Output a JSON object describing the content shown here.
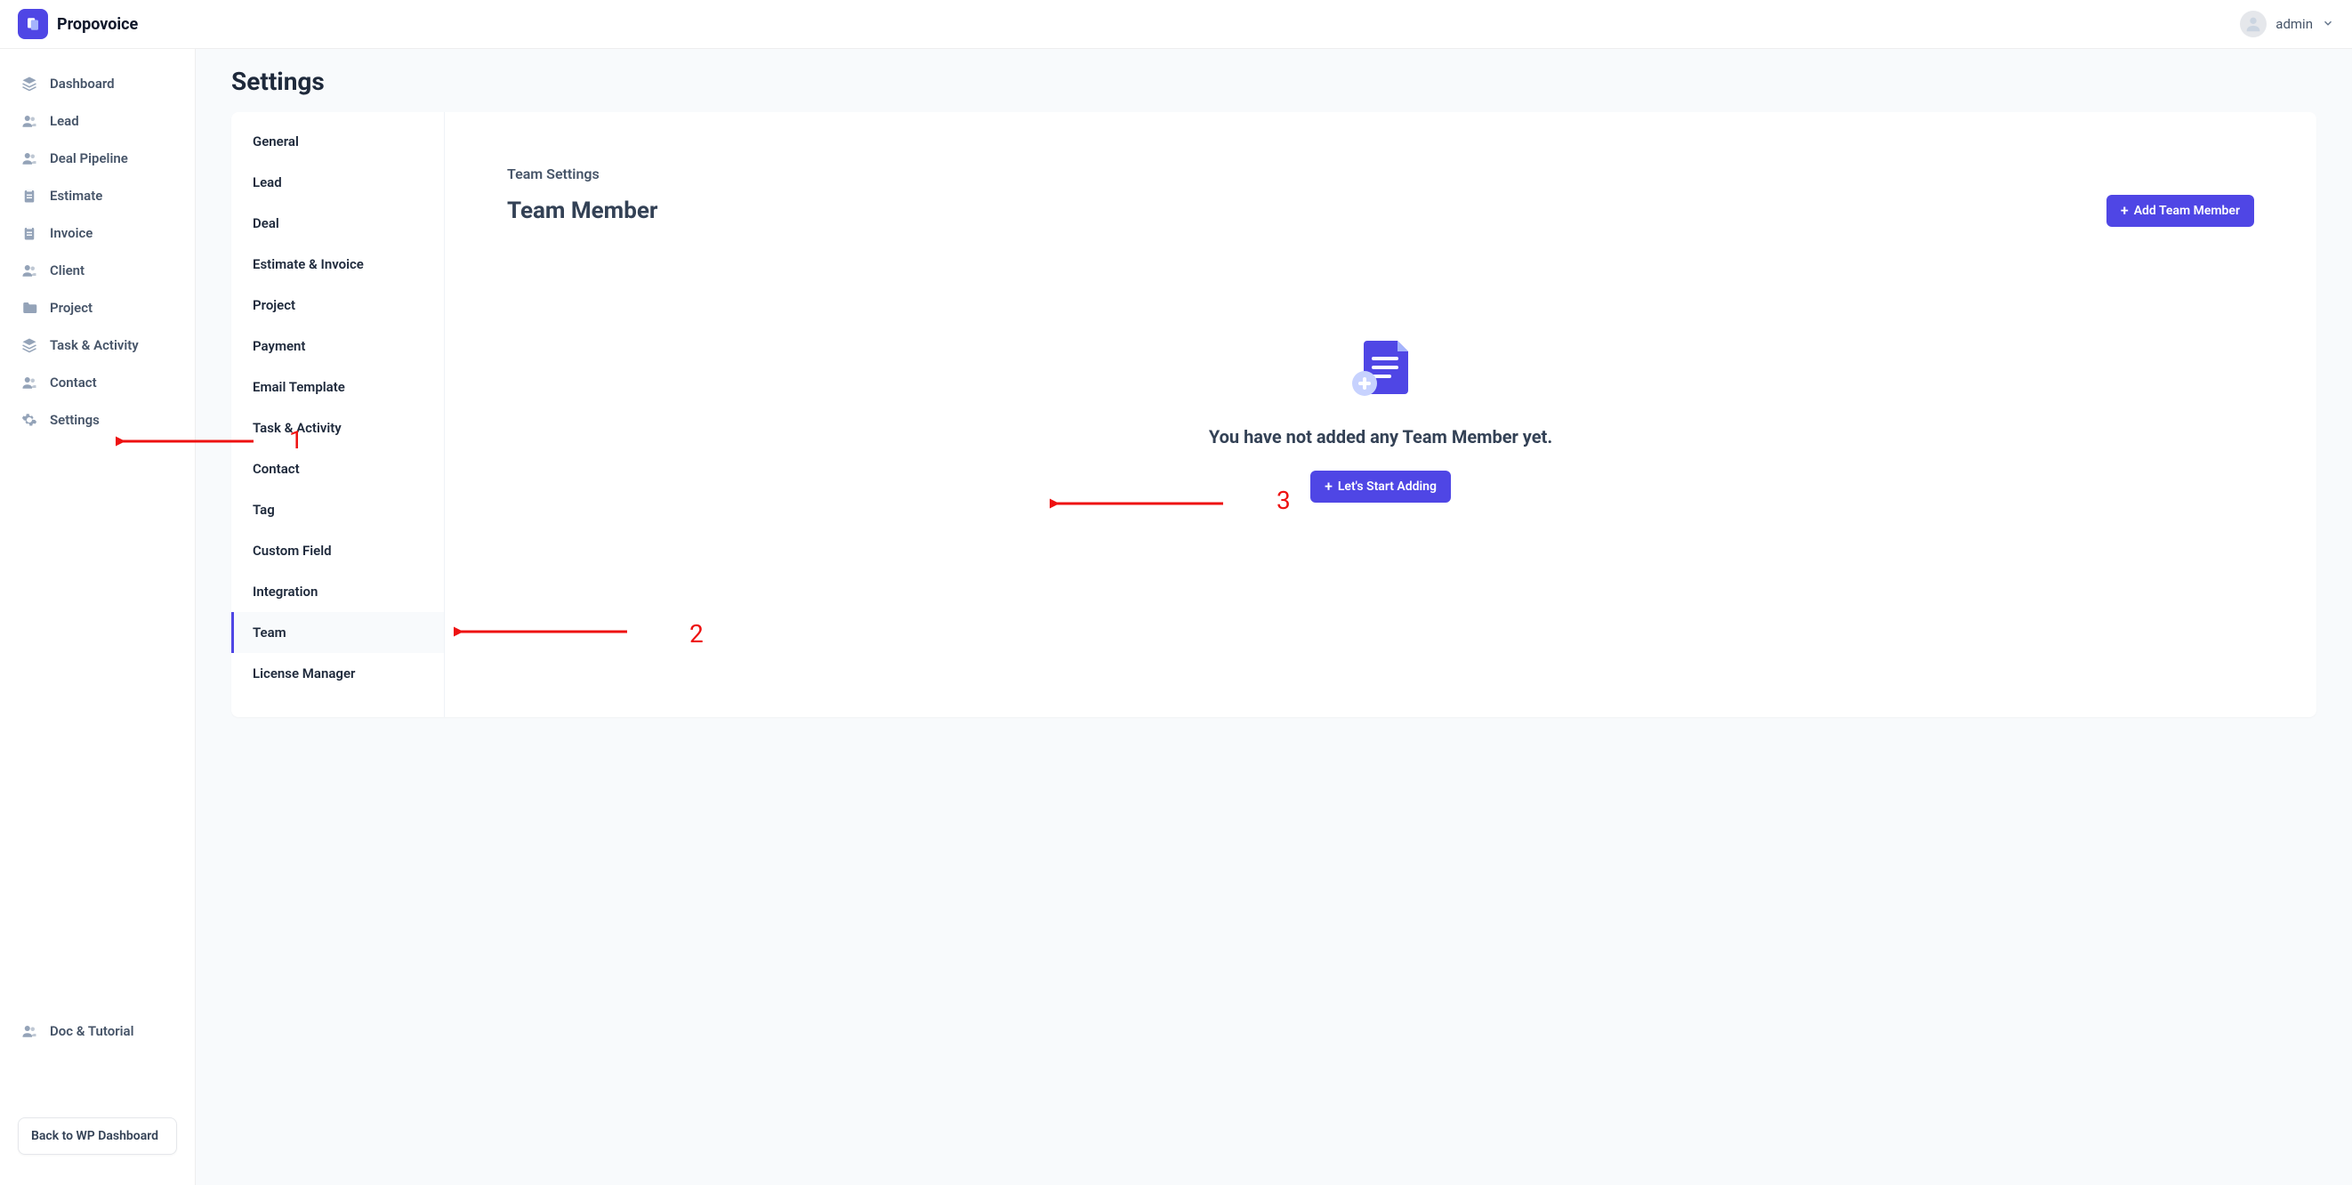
{
  "brand": {
    "name": "Propovoice"
  },
  "user": {
    "name": "admin"
  },
  "sidebar": {
    "items": [
      {
        "label": "Dashboard",
        "icon": "layers"
      },
      {
        "label": "Lead",
        "icon": "users"
      },
      {
        "label": "Deal Pipeline",
        "icon": "users"
      },
      {
        "label": "Estimate",
        "icon": "clipboard"
      },
      {
        "label": "Invoice",
        "icon": "clipboard"
      },
      {
        "label": "Client",
        "icon": "users"
      },
      {
        "label": "Project",
        "icon": "folder"
      },
      {
        "label": "Task & Activity",
        "icon": "layers"
      },
      {
        "label": "Contact",
        "icon": "users"
      },
      {
        "label": "Settings",
        "icon": "gear"
      }
    ],
    "secondary": [
      {
        "label": "Doc & Tutorial",
        "icon": "users"
      }
    ],
    "back_label": "Back to WP Dashboard"
  },
  "page": {
    "title": "Settings"
  },
  "subnav": {
    "items": [
      "General",
      "Lead",
      "Deal",
      "Estimate & Invoice",
      "Project",
      "Payment",
      "Email Template",
      "Task & Activity",
      "Contact",
      "Tag",
      "Custom Field",
      "Integration",
      "Team",
      "License Manager"
    ],
    "active_index": 12
  },
  "detail": {
    "section_label": "Team Settings",
    "section_title": "Team Member",
    "add_button": "Add Team Member",
    "empty_text": "You have not added any Team Member yet.",
    "start_button": "Let's Start Adding"
  },
  "annotations": {
    "1": "1",
    "2": "2",
    "3": "3"
  }
}
